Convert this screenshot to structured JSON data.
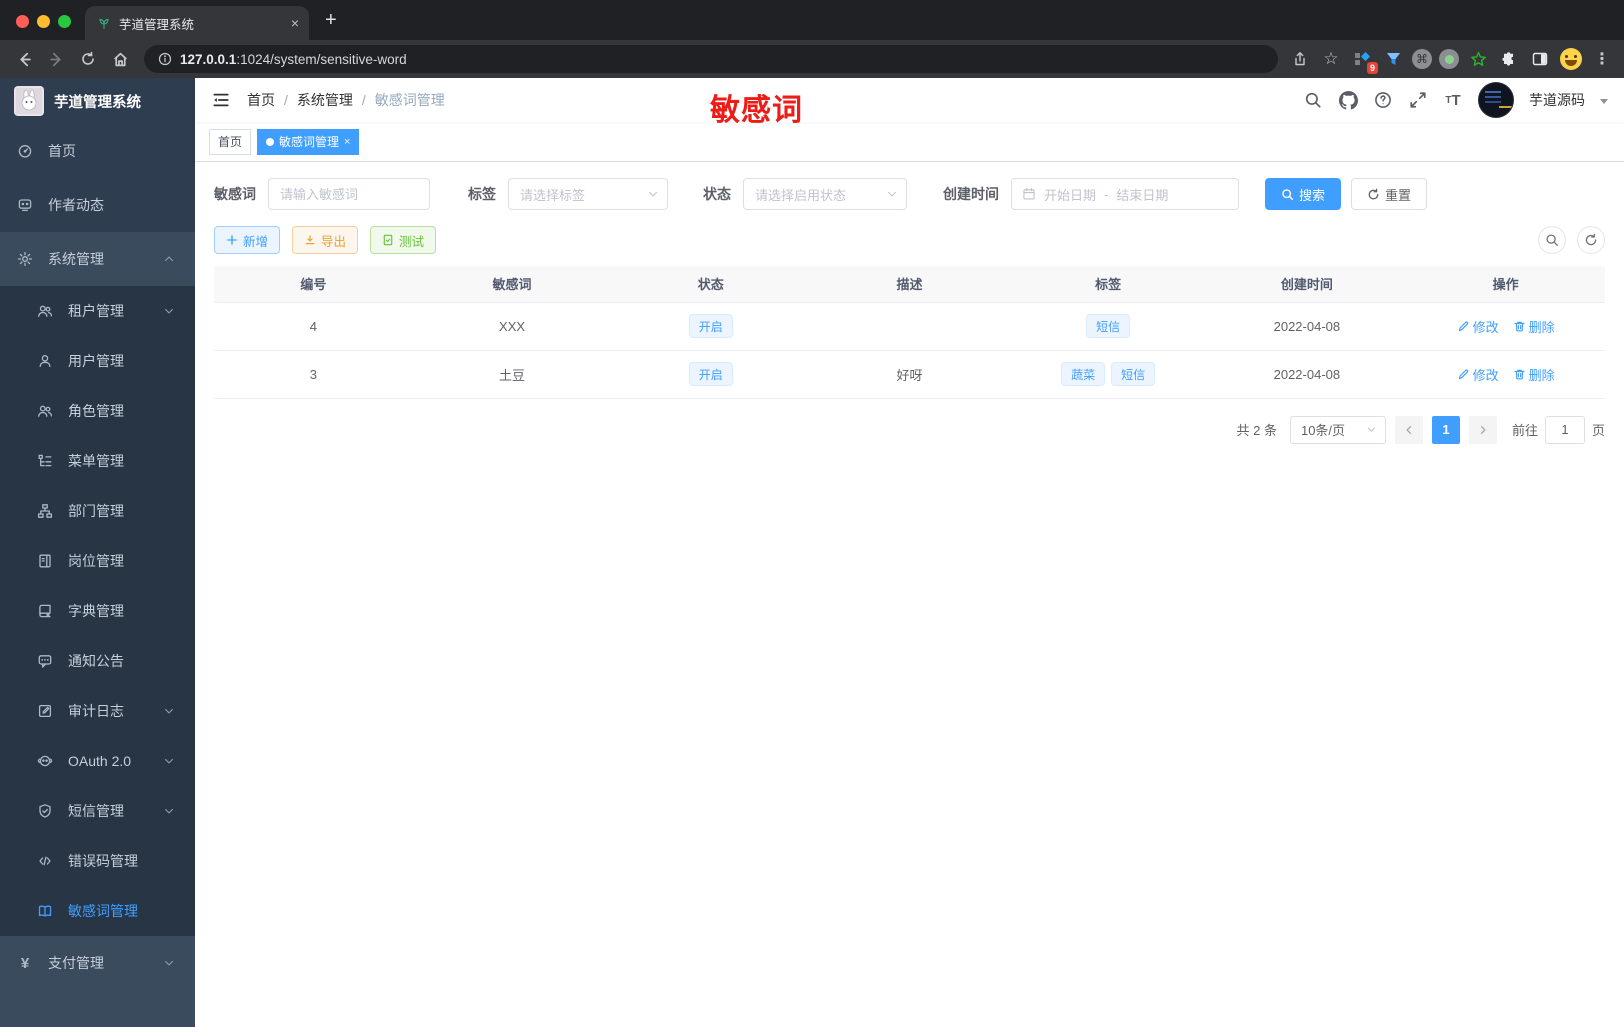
{
  "browser": {
    "tab_title": "芋道管理系统",
    "url_host": "127.0.0.1",
    "url_path": ":1024/system/sensitive-word",
    "extension_badge": "9",
    "close_glyph": "×",
    "plus_glyph": "+",
    "menu_glyph": "⋮",
    "star_glyph": "☆",
    "cmd_glyph": "⌘"
  },
  "sidebar": {
    "app_title": "芋道管理系统",
    "items": [
      {
        "icon": "gauge",
        "label": "首页",
        "level": "root"
      },
      {
        "icon": "chat",
        "label": "作者动态",
        "level": "root"
      },
      {
        "icon": "gear",
        "label": "系统管理",
        "level": "root",
        "chevron": "up",
        "highlight": true
      },
      {
        "icon": "users",
        "label": "租户管理",
        "level": "sub",
        "chevron": "down"
      },
      {
        "icon": "user",
        "label": "用户管理",
        "level": "sub"
      },
      {
        "icon": "users",
        "label": "角色管理",
        "level": "sub"
      },
      {
        "icon": "menutree",
        "label": "菜单管理",
        "level": "sub"
      },
      {
        "icon": "org",
        "label": "部门管理",
        "level": "sub"
      },
      {
        "icon": "postcard",
        "label": "岗位管理",
        "level": "sub"
      },
      {
        "icon": "dict",
        "label": "字典管理",
        "level": "sub"
      },
      {
        "icon": "notice",
        "label": "通知公告",
        "level": "sub"
      },
      {
        "icon": "auditpen",
        "label": "审计日志",
        "level": "sub",
        "chevron": "down"
      },
      {
        "icon": "oauth",
        "label": "OAuth 2.0",
        "level": "sub",
        "chevron": "down"
      },
      {
        "icon": "shield",
        "label": "短信管理",
        "level": "sub",
        "chevron": "down"
      },
      {
        "icon": "code",
        "label": "错误码管理",
        "level": "sub"
      },
      {
        "icon": "openbook",
        "label": "敏感词管理",
        "level": "sub",
        "active": true
      },
      {
        "icon": "yen",
        "label": "支付管理",
        "level": "pay",
        "chevron": "down",
        "highlight": true
      }
    ]
  },
  "header": {
    "breadcrumb": [
      "首页",
      "系统管理",
      "敏感词管理"
    ],
    "separator": "/",
    "annotation": "敏感词",
    "username": "芋道源码"
  },
  "tabsbar": {
    "tabs": [
      {
        "label": "首页"
      },
      {
        "label": "敏感词管理"
      }
    ]
  },
  "filters": {
    "keyword_label": "敏感词",
    "keyword_placeholder": "请输入敏感词",
    "tag_label": "标签",
    "tag_placeholder": "请选择标签",
    "status_label": "状态",
    "status_placeholder": "请选择启用状态",
    "date_label": "创建时间",
    "date_start_placeholder": "开始日期",
    "date_separator": "-",
    "date_end_placeholder": "结束日期",
    "search_label": "搜索",
    "reset_label": "重置"
  },
  "toolbar": {
    "add_label": "新增",
    "export_label": "导出",
    "test_label": "测试"
  },
  "table": {
    "columns": [
      "编号",
      "敏感词",
      "状态",
      "描述",
      "标签",
      "创建时间",
      "操作"
    ],
    "rows": [
      {
        "id": "4",
        "word": "XXX",
        "status": "开启",
        "description": "",
        "tags": [
          "短信"
        ],
        "created": "2022-04-08"
      },
      {
        "id": "3",
        "word": "土豆",
        "status": "开启",
        "description": "好呀",
        "tags": [
          "蔬菜",
          "短信"
        ],
        "created": "2022-04-08"
      }
    ],
    "edit_label": "修改",
    "delete_label": "删除"
  },
  "pagination": {
    "total_text": "共 2 条",
    "page_size": "10条/页",
    "current_page": "1",
    "goto_label": "前往",
    "goto_value": "1",
    "page_label": "页"
  },
  "colors": {
    "accent": "#409eff",
    "annotation_red": "#ed1c16",
    "sidebar_bg": "#2e3d4f"
  }
}
